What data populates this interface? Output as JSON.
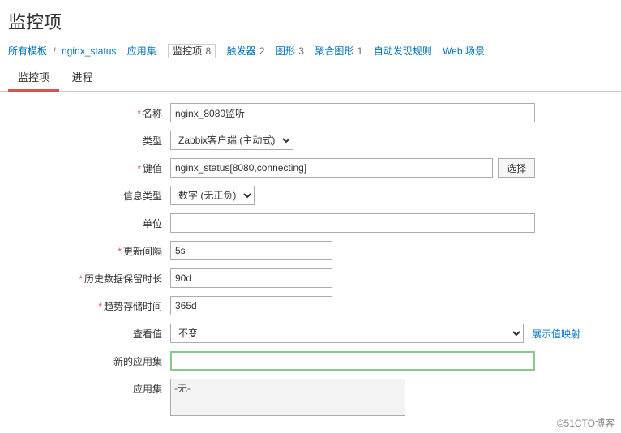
{
  "page_title": "监控项",
  "breadcrumb": {
    "root": "所有模板",
    "template": "nginx_status",
    "tabs": [
      {
        "label": "应用集",
        "count": ""
      },
      {
        "label": "监控项",
        "count": "8",
        "current": true
      },
      {
        "label": "触发器",
        "count": "2"
      },
      {
        "label": "图形",
        "count": "3"
      },
      {
        "label": "聚合图形",
        "count": "1"
      },
      {
        "label": "自动发现规则",
        "count": ""
      },
      {
        "label": "Web 场景",
        "count": ""
      }
    ]
  },
  "subtabs": {
    "item": "监控项",
    "process": "进程"
  },
  "form": {
    "name": {
      "label": "名称",
      "value": "nginx_8080监听"
    },
    "type": {
      "label": "类型",
      "value": "Zabbix客户端 (主动式)"
    },
    "key": {
      "label": "键值",
      "value": "nginx_status[8080,connecting]",
      "select_btn": "选择"
    },
    "info_type": {
      "label": "信息类型",
      "value": "数字 (无正负)"
    },
    "units": {
      "label": "单位",
      "value": ""
    },
    "interval": {
      "label": "更新间隔",
      "value": "5s"
    },
    "history": {
      "label": "历史数据保留时长",
      "value": "90d"
    },
    "trends": {
      "label": "趋势存储时间",
      "value": "365d"
    },
    "show_value": {
      "label": "查看值",
      "value": "不变",
      "map_link": "展示值映射"
    },
    "new_app": {
      "label": "新的应用集",
      "value": ""
    },
    "apps": {
      "label": "应用集",
      "none": "-无-"
    }
  },
  "watermark": "©51CTO博客"
}
